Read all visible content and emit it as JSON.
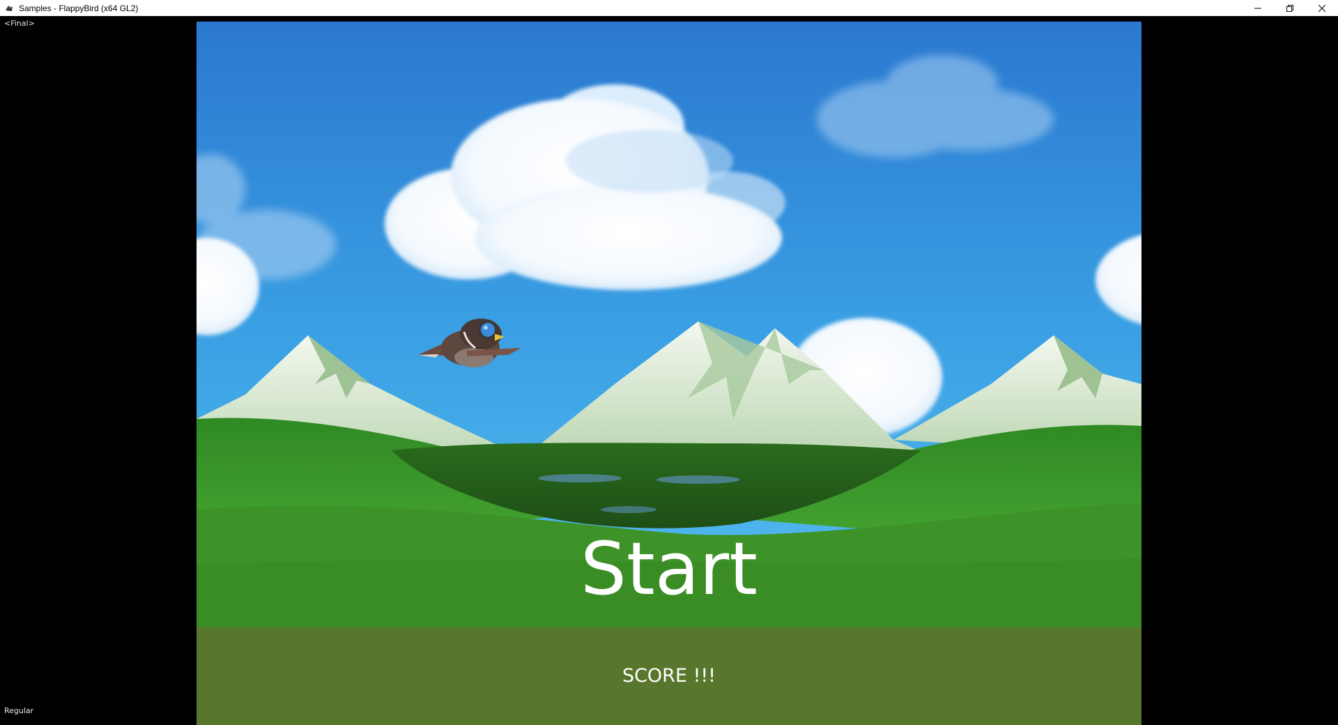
{
  "window": {
    "title": "Samples - FlappyBird (x64 GL2)",
    "icons": {
      "app": "app-icon",
      "minimize": "minimize-icon",
      "restore": "restore-icon",
      "close": "close-icon"
    }
  },
  "debug": {
    "top_left_label": "<Final>",
    "bottom_left_label": "Regular"
  },
  "game": {
    "start_label": "Start",
    "score_label": "SCORE !!!",
    "colors": {
      "sky_top": "#2e7fd3",
      "sky_bottom": "#48b2ea",
      "grass": "#3e9428",
      "ground_bar": "#58772c",
      "text": "#ffffff"
    }
  }
}
